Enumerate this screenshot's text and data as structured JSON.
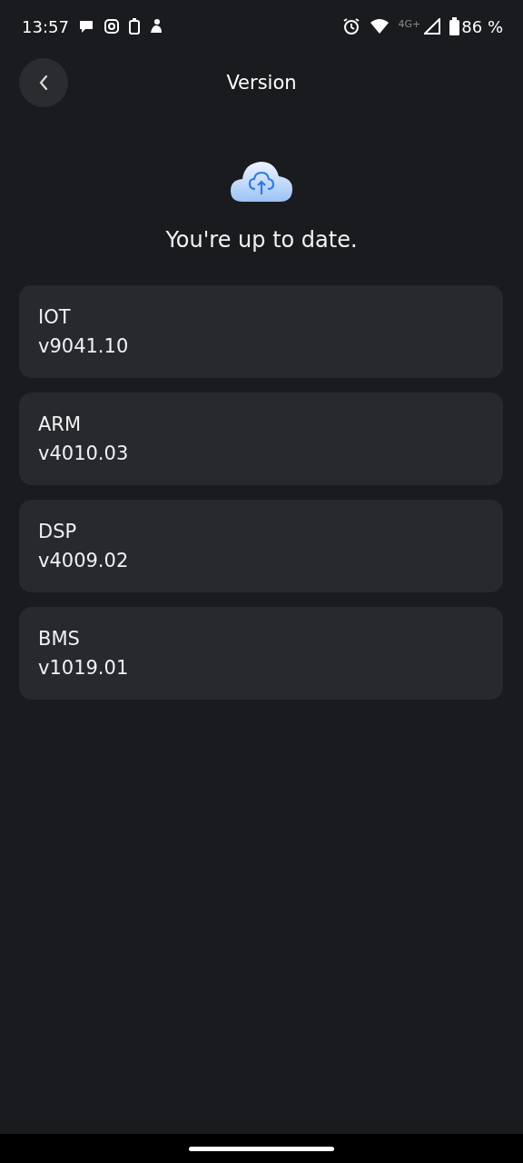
{
  "status_bar": {
    "time": "13:57",
    "network": "4G+",
    "battery": "86 %"
  },
  "header": {
    "title": "Version"
  },
  "status_message": "You're up to date.",
  "modules": [
    {
      "name": "IOT",
      "version": "v9041.10"
    },
    {
      "name": "ARM",
      "version": "v4010.03"
    },
    {
      "name": "DSP",
      "version": "v4009.02"
    },
    {
      "name": "BMS",
      "version": "v1019.01"
    }
  ]
}
